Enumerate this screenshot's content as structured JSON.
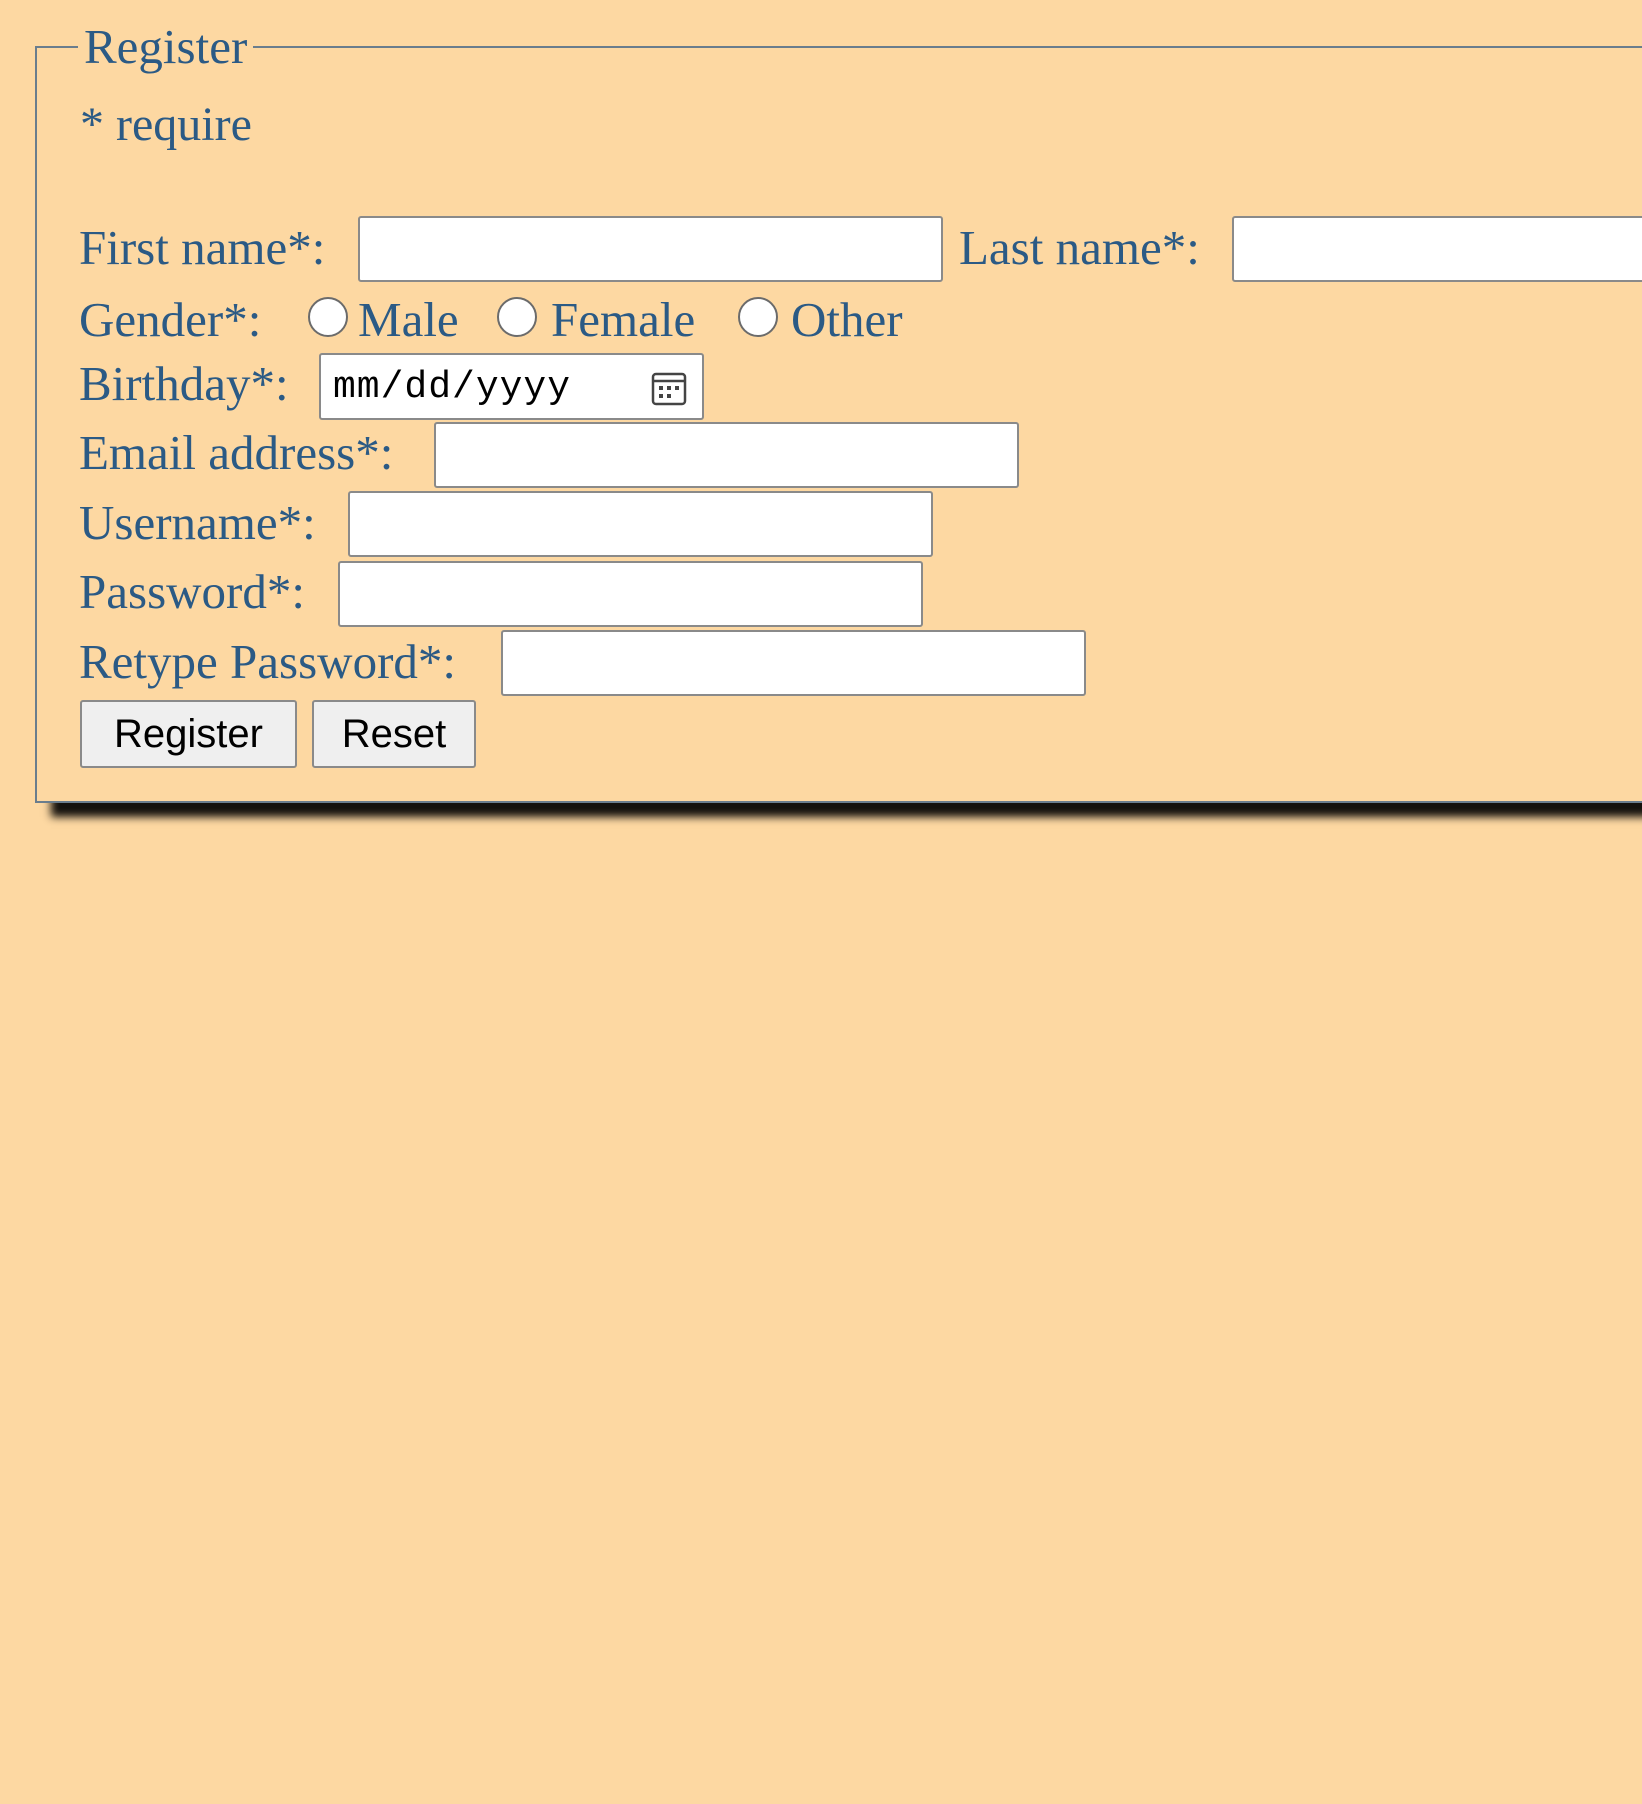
{
  "form": {
    "legend": "Register",
    "require_note": "* require",
    "first_name": {
      "label": "First name*:",
      "value": ""
    },
    "last_name": {
      "label": "Last name*:",
      "value": ""
    },
    "gender": {
      "label": "Gender*:",
      "options": [
        "Male",
        "Female",
        "Other"
      ],
      "selected": null
    },
    "birthday": {
      "label": "Birthday*:",
      "placeholder": "mm/dd/yyyy",
      "icon": "calendar-icon"
    },
    "email": {
      "label": "Email address*:",
      "value": ""
    },
    "username": {
      "label": "Username*:",
      "value": ""
    },
    "password": {
      "label": "Password*:",
      "value": ""
    },
    "retype_password": {
      "label": "Retype Password*:",
      "value": ""
    },
    "buttons": {
      "register": "Register",
      "reset": "Reset"
    }
  },
  "colors": {
    "page_background": "#fdd8a2",
    "label_text": "#2b5a85",
    "border": "#6a7d8d",
    "shadow": "#000000"
  }
}
